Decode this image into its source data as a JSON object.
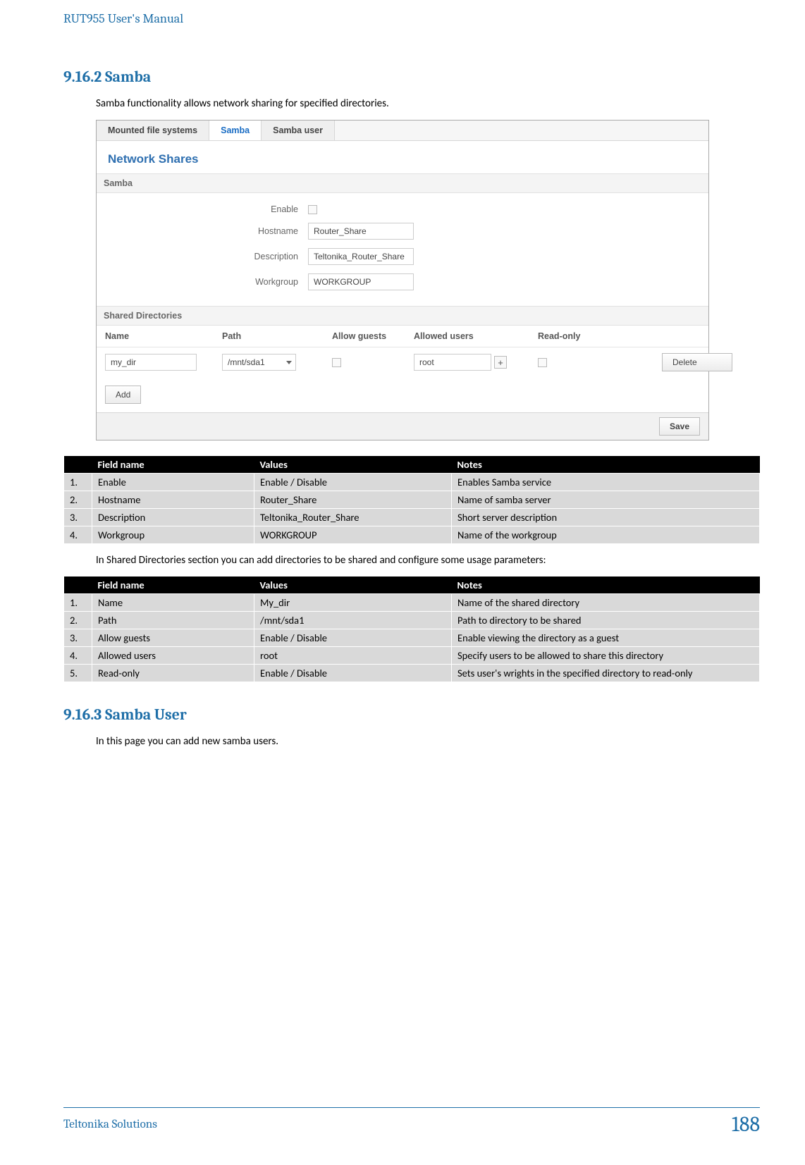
{
  "header": {
    "title": "RUT955 User's Manual"
  },
  "section1": {
    "number": "9.16.2",
    "name": "Samba",
    "intro": "Samba functionality allows network sharing for specified directories."
  },
  "shot": {
    "tabs": [
      {
        "label": "Mounted file systems",
        "active": false
      },
      {
        "label": "Samba",
        "active": true
      },
      {
        "label": "Samba user",
        "active": false
      }
    ],
    "sectionTitle": "Network Shares",
    "panel1": "Samba",
    "fields": {
      "enableLabel": "Enable",
      "hostnameLabel": "Hostname",
      "hostnameValue": "Router_Share",
      "descriptionLabel": "Description",
      "descriptionValue": "Teltonika_Router_Share",
      "workgroupLabel": "Workgroup",
      "workgroupValue": "WORKGROUP"
    },
    "panel2": "Shared Directories",
    "dirHeader": {
      "name": "Name",
      "path": "Path",
      "allowGuests": "Allow guests",
      "allowedUsers": "Allowed users",
      "readOnly": "Read-only"
    },
    "dirRow": {
      "name": "my_dir",
      "path": "/mnt/sda1",
      "allowedUsers": "root",
      "deleteBtn": "Delete"
    },
    "addBtn": "Add",
    "saveBtn": "Save"
  },
  "table1": {
    "columns": {
      "num": "",
      "field": "Field name",
      "values": "Values",
      "notes": "Notes"
    },
    "rows": [
      {
        "n": "1.",
        "field": "Enable",
        "values": "Enable / Disable",
        "notes": "Enables Samba service"
      },
      {
        "n": "2.",
        "field": "Hostname",
        "values": "Router_Share",
        "notes": "Name of samba server"
      },
      {
        "n": "3.",
        "field": "Description",
        "values": "Teltonika_Router_Share",
        "notes": "Short server description"
      },
      {
        "n": "4.",
        "field": "Workgroup",
        "values": "WORKGROUP",
        "notes": "Name of the workgroup"
      }
    ]
  },
  "midText": "In Shared Directories section you can add directories to be shared and configure some usage parameters:",
  "table2": {
    "columns": {
      "num": "",
      "field": "Field name",
      "values": "Values",
      "notes": "Notes"
    },
    "rows": [
      {
        "n": "1.",
        "field": "Name",
        "values": "My_dir",
        "notes": "Name of the shared directory"
      },
      {
        "n": "2.",
        "field": "Path",
        "values": "/mnt/sda1",
        "notes": "Path to directory to be shared"
      },
      {
        "n": "3.",
        "field": "Allow guests",
        "values": "Enable / Disable",
        "notes": "Enable viewing the directory as a guest"
      },
      {
        "n": "4.",
        "field": "Allowed users",
        "values": "root",
        "notes": "Specify users to be allowed to share this directory"
      },
      {
        "n": "5.",
        "field": "Read-only",
        "values": "Enable / Disable",
        "notes": "Sets user's wrights in the specified directory to read-only"
      }
    ]
  },
  "section2": {
    "number": "9.16.3",
    "name": "Samba User",
    "intro": "In this page you can add new samba users."
  },
  "footer": {
    "source": "Teltonika Solutions",
    "page": "188"
  }
}
